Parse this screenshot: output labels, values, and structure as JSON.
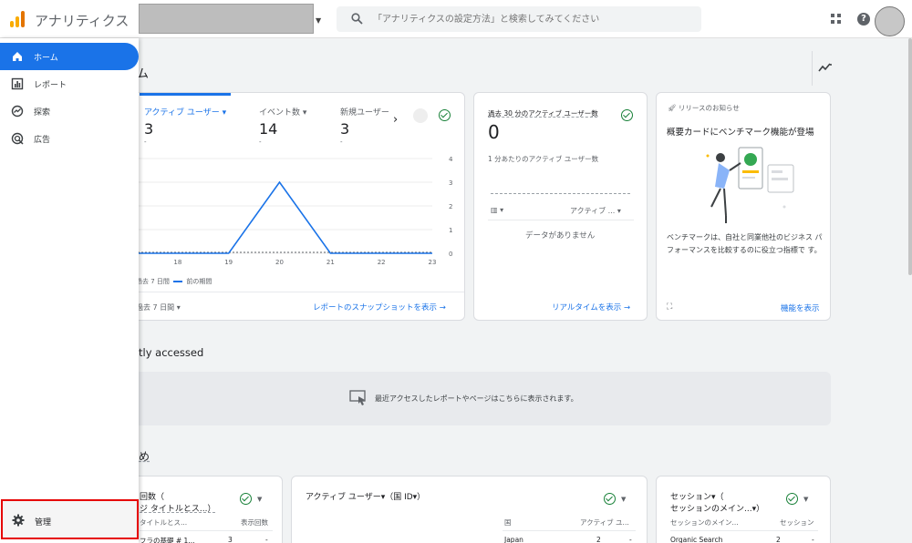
{
  "header": {
    "app_title": "アナリティクス",
    "search_placeholder": "「アナリティクスの設定方法」と検索してみてください"
  },
  "sidebar": {
    "items": [
      {
        "label": "ホーム"
      },
      {
        "label": "レポート"
      },
      {
        "label": "探索"
      },
      {
        "label": "広告"
      }
    ],
    "admin_label": "管理"
  },
  "page": {
    "title_fragment": "ム",
    "recent_title": "tly accessed",
    "recent_empty": "最近アクセスしたレポートやページはこちらに表示されます。",
    "suggest_title": "め"
  },
  "overview": {
    "metrics": [
      {
        "label": "アクティブ ユーザー",
        "value": "3",
        "sub": "-"
      },
      {
        "label": "イベント数",
        "value": "14",
        "sub": "-"
      },
      {
        "label": "新規ユーザー",
        "value": "3",
        "sub": "-"
      }
    ],
    "legend_current": "過去 7 日間",
    "legend_prev": "前の期間",
    "date_range": "過去 7 日間",
    "snapshot_link": "レポートのスナップショットを表示"
  },
  "chart_data": {
    "type": "line",
    "x": [
      "17",
      "18",
      "19",
      "20",
      "21",
      "22",
      "23"
    ],
    "series": [
      {
        "values": [
          0,
          0,
          0,
          3,
          0,
          0,
          0
        ]
      }
    ],
    "xticks_shown": [
      "18",
      "19",
      "20",
      "21",
      "22",
      "23"
    ],
    "yticks": [
      "4",
      "3",
      "2",
      "1",
      "0"
    ],
    "ylim": [
      0,
      4
    ],
    "color": "#1a73e8"
  },
  "realtime": {
    "title": "過去 30 分のアクティブ ユーザー数",
    "value": "0",
    "per_minute": "1 分あたりのアクティブ ユーザー数",
    "col_left": "▥",
    "col_right": "アクティブ ...",
    "empty": "データがありません",
    "link": "リアルタイムを表示"
  },
  "release": {
    "heading": "リリースのお知らせ",
    "title": "概要カードにベンチマーク機能が登場",
    "body": "ベンチマークは、自社と同業他社のビジネス パフォーマンスを比較するのに役立つ指標で す。",
    "link": "機能を表示"
  },
  "cards_bottom": [
    {
      "title_line1": "回数（",
      "title_line2": "ジ タイトルとス...）",
      "col1": "タイトルとス...",
      "col2": "表示回数",
      "row_label": "フラの基礎 # 1...",
      "row_value": "3",
      "row_change": "-"
    },
    {
      "title": "アクティブ ユーザー▾（国 ID▾）",
      "col1": "国",
      "col2": "アクティブ ユ...",
      "row_label": "Japan",
      "row_value": "2",
      "row_change": "-"
    },
    {
      "title_line1": "セッション▾（",
      "title_line2": "セッションのメイン...▾）",
      "col1": "セッションのメイン...",
      "col2": "セッション",
      "row_label": "Organic Search",
      "row_value": "2",
      "row_change": "-"
    }
  ]
}
